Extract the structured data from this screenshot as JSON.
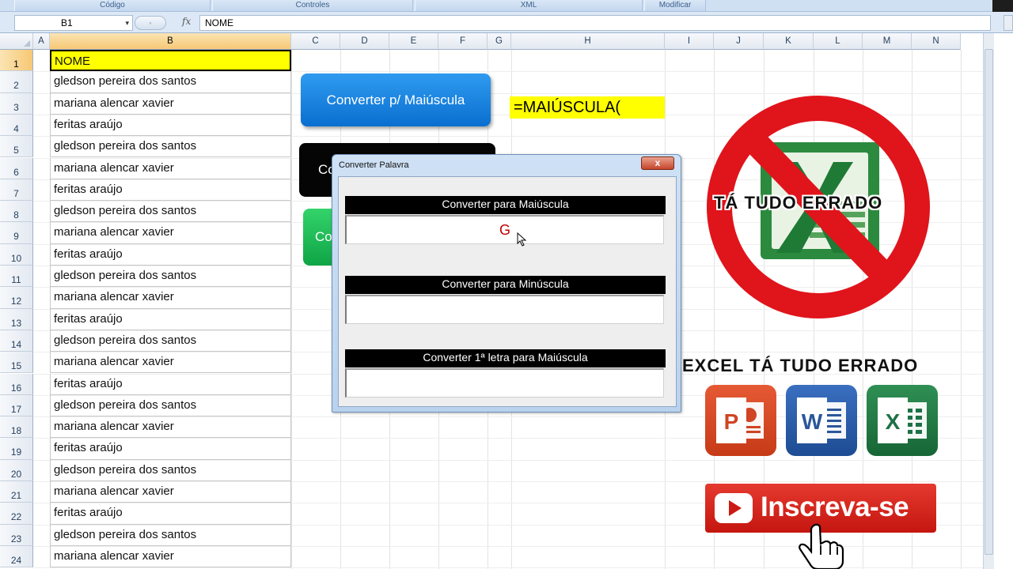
{
  "ribbon": {
    "groups": [
      "Código",
      "Controles",
      "XML",
      "Modificar"
    ]
  },
  "formula_bar": {
    "name_box": "B1",
    "name_dropdown": "▾",
    "fx_label": "fx",
    "formula": "NOME"
  },
  "columns": [
    "A",
    "B",
    "C",
    "D",
    "E",
    "F",
    "G",
    "H",
    "I",
    "J",
    "K",
    "L",
    "M",
    "N"
  ],
  "rows": [
    {
      "num": "1",
      "value": "NOME"
    },
    {
      "num": "2",
      "value": "gledson pereira dos santos"
    },
    {
      "num": "3",
      "value": "mariana alencar xavier"
    },
    {
      "num": "4",
      "value": "feritas araújo"
    },
    {
      "num": "5",
      "value": "gledson pereira dos santos"
    },
    {
      "num": "6",
      "value": "mariana alencar xavier"
    },
    {
      "num": "7",
      "value": "feritas araújo"
    },
    {
      "num": "8",
      "value": "gledson pereira dos santos"
    },
    {
      "num": "9",
      "value": "mariana alencar xavier"
    },
    {
      "num": "10",
      "value": "feritas araújo"
    },
    {
      "num": "11",
      "value": "gledson pereira dos santos"
    },
    {
      "num": "12",
      "value": "mariana alencar xavier"
    },
    {
      "num": "13",
      "value": "feritas araújo"
    },
    {
      "num": "14",
      "value": "gledson pereira dos santos"
    },
    {
      "num": "15",
      "value": "mariana alencar xavier"
    },
    {
      "num": "16",
      "value": "feritas araújo"
    },
    {
      "num": "17",
      "value": "gledson pereira dos santos"
    },
    {
      "num": "18",
      "value": "mariana alencar xavier"
    },
    {
      "num": "19",
      "value": "feritas araújo"
    },
    {
      "num": "20",
      "value": "gledson pereira dos santos"
    },
    {
      "num": "21",
      "value": "mariana alencar xavier"
    },
    {
      "num": "22",
      "value": "feritas araújo"
    },
    {
      "num": "23",
      "value": "gledson pereira dos santos"
    },
    {
      "num": "24",
      "value": "mariana alencar xavier"
    }
  ],
  "sheet_buttons": {
    "uppercase": "Converter p/ Maiúscula",
    "black_partial": "Co",
    "green_partial": "Co"
  },
  "formula_note": "=MAIÚSCULA(",
  "dialog": {
    "title": "Converter Palavra",
    "close": "x",
    "sections": [
      {
        "label": "Converter para Maiúscula",
        "value": "G"
      },
      {
        "label": "Converter para Minúscula",
        "value": ""
      },
      {
        "label": "Converter 1ª letra para Maiúscula",
        "value": ""
      }
    ]
  },
  "promo": {
    "sign_text": "TÁ TUDO ERRADO",
    "banner_text": "EXCEL TÁ TUDO ERRADO",
    "apps": [
      {
        "letter": "P",
        "name": "powerpoint",
        "color": "#d04423"
      },
      {
        "letter": "W",
        "name": "word",
        "color": "#2b579a"
      },
      {
        "letter": "X",
        "name": "excel",
        "color": "#1e7145"
      }
    ],
    "subscribe": "Inscreva-se"
  },
  "colors": {
    "header_yellow": "#ffff00",
    "button_blue": "#0a6fd0",
    "button_green": "#0fa546",
    "no_sign_red": "#e0141b",
    "subscribe_red": "#d0201a"
  }
}
